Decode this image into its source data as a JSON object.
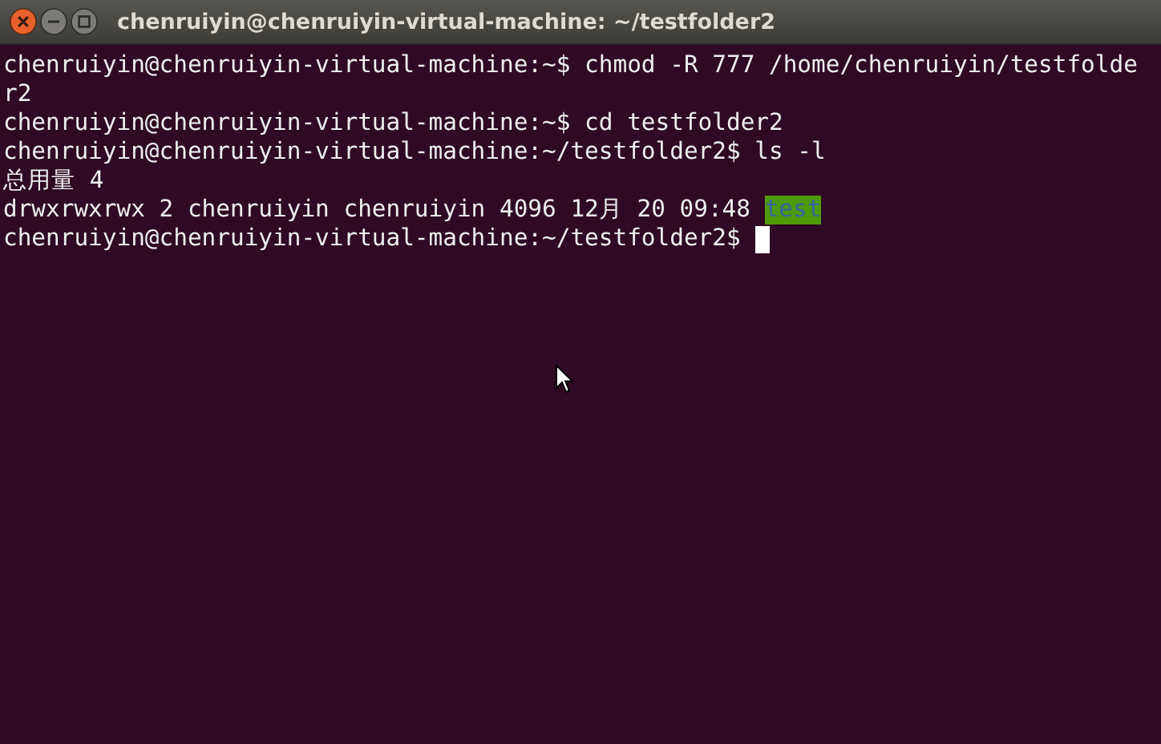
{
  "window": {
    "title": "chenruiyin@chenruiyin-virtual-machine: ~/testfolder2"
  },
  "lines": [
    {
      "cursor": false,
      "segments": [
        {
          "kind": "plain",
          "text": "chenruiyin@chenruiyin-virtual-machine:~$ chmod -R 777 /home/chenruiyin/testfolde"
        }
      ]
    },
    {
      "cursor": false,
      "segments": [
        {
          "kind": "plain",
          "text": "r2"
        }
      ]
    },
    {
      "cursor": false,
      "segments": [
        {
          "kind": "plain",
          "text": "chenruiyin@chenruiyin-virtual-machine:~$ cd testfolder2"
        }
      ]
    },
    {
      "cursor": false,
      "segments": [
        {
          "kind": "plain",
          "text": "chenruiyin@chenruiyin-virtual-machine:~/testfolder2$ ls -l"
        }
      ]
    },
    {
      "cursor": false,
      "segments": [
        {
          "kind": "plain",
          "text": "总用量 4"
        }
      ]
    },
    {
      "cursor": false,
      "segments": [
        {
          "kind": "plain",
          "text": "drwxrwxrwx 2 chenruiyin chenruiyin 4096 12月 20 09:48 "
        },
        {
          "kind": "other-writable-dir",
          "text": "test"
        }
      ]
    },
    {
      "cursor": true,
      "segments": [
        {
          "kind": "plain",
          "text": "chenruiyin@chenruiyin-virtual-machine:~/testfolder2$ "
        }
      ]
    }
  ]
}
